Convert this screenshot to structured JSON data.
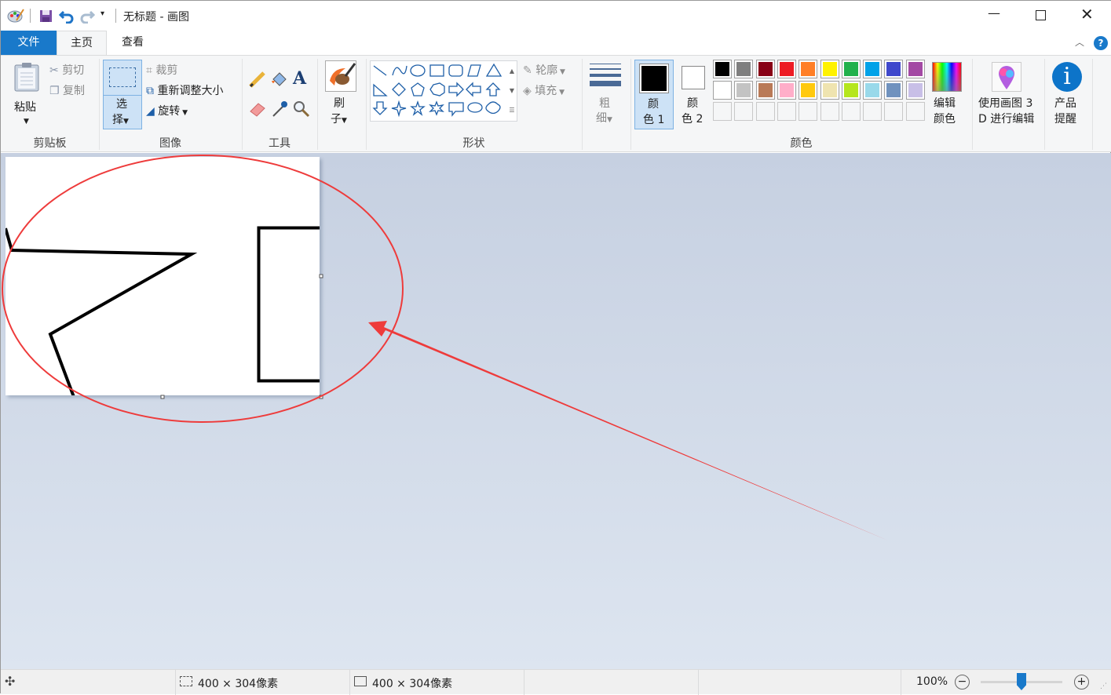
{
  "window": {
    "title": "无标题 - 画图"
  },
  "tabs": [
    {
      "label": "文件"
    },
    {
      "label": "主页"
    },
    {
      "label": "查看"
    }
  ],
  "clipboard": {
    "paste": "粘贴",
    "cut": "剪切",
    "copy": "复制",
    "group": "剪贴板"
  },
  "image": {
    "select_1": "选",
    "select_2": "择",
    "crop": "裁剪",
    "resize": "重新调整大小",
    "rotate": "旋转",
    "group": "图像"
  },
  "tools": {
    "group": "工具",
    "text_tool": "A"
  },
  "brushes": {
    "label_1": "刷",
    "label_2": "子"
  },
  "shapes": {
    "outline": "轮廓",
    "fill": "填充",
    "group": "形状"
  },
  "size": {
    "label_1": "粗",
    "label_2": "细"
  },
  "colors": {
    "color1_1": "颜",
    "color1_2": "色 1",
    "color2_1": "颜",
    "color2_2": "色 2",
    "edit_1": "编辑",
    "edit_2": "颜色",
    "group": "颜色",
    "palette_row1": [
      "#000000",
      "#7f7f7f",
      "#880015",
      "#ed1c24",
      "#ff7f27",
      "#fff200",
      "#22b14c",
      "#00a2e8",
      "#3f48cc",
      "#a349a4"
    ],
    "palette_row2": [
      "#ffffff",
      "#c3c3c3",
      "#b97a57",
      "#ffaec9",
      "#ffc90e",
      "#efe4b0",
      "#b5e61d",
      "#99d9ea",
      "#7092be",
      "#c8bfe7"
    ],
    "color1": "#000000",
    "color2": "#ffffff"
  },
  "paint3d": {
    "label_1": "使用画图 3",
    "label_2": "D 进行编辑"
  },
  "product": {
    "label_1": "产品",
    "label_2": "提醒"
  },
  "status": {
    "selection_size": "400 × 304像素",
    "canvas_size": "400 × 304像素",
    "zoom": "100%",
    "zoom_value": 100
  },
  "annotation_color": "#ee3b3b"
}
